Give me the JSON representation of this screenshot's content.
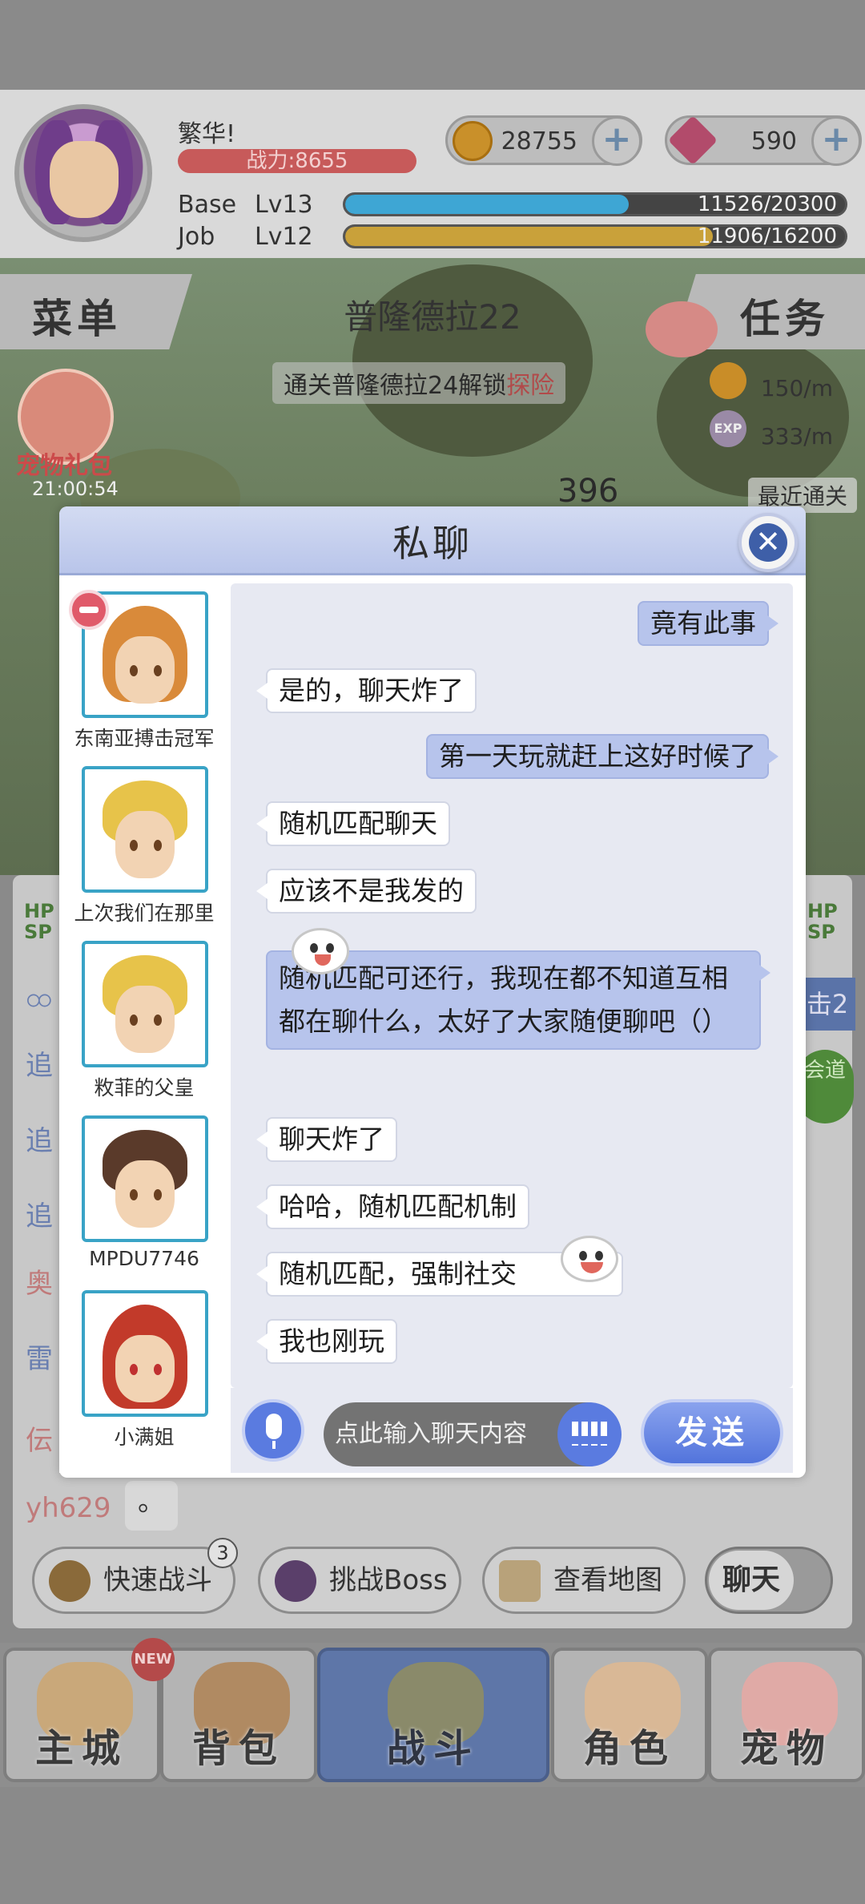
{
  "player": {
    "name": "繁华!",
    "power": "战力:8655",
    "base_label": "Base",
    "base_level": "Lv13",
    "base_exp": "11526/20300",
    "base_fraction": 0.568,
    "job_label": "Job",
    "job_level": "Lv12",
    "job_exp": "11906/16200",
    "job_fraction": 0.735
  },
  "currency": {
    "coins": "28755",
    "gems": "590",
    "plus": "+"
  },
  "hud": {
    "menu_label": "菜单",
    "task_label": "任务",
    "map_name": "普隆德拉22",
    "quest_hint_prefix": "通关普隆德拉24解锁",
    "quest_hint_action": "探险",
    "pet_gift_label": "宠物礼包",
    "pet_gift_timer": "21:00:54",
    "coin_rate": "150/m",
    "exp_rate": "333/m",
    "exp_tag": "EXP",
    "counter": "396",
    "recent_clear": "最近通关"
  },
  "background_chat": {
    "hp_tag": "HP",
    "sp_tag": "SP",
    "lines": [
      "ထ",
      "追",
      "追",
      "追",
      "奥",
      "雷",
      "伝"
    ],
    "last_sender": "yh629",
    "last_message": "。",
    "right_badge": "击2",
    "right_green": "会道"
  },
  "actions": {
    "quick_battle": "快速战斗",
    "quick_battle_badge": "3",
    "challenge_boss": "挑战Boss",
    "view_map": "查看地图",
    "chat_toggle": "聊天"
  },
  "nav": {
    "new_tag": "NEW",
    "items": [
      {
        "label": "主城"
      },
      {
        "label": "背包"
      },
      {
        "label": "战斗"
      },
      {
        "label": "角色"
      },
      {
        "label": "宠物"
      }
    ]
  },
  "private_chat": {
    "title": "私聊",
    "close": "✕",
    "contacts": [
      {
        "name": "东南亚搏击冠军"
      },
      {
        "name": "上次我们在那里"
      },
      {
        "name": "敉菲的父皇"
      },
      {
        "name": "MPDU7746"
      },
      {
        "name": "小满姐"
      }
    ],
    "messages": [
      {
        "side": "right",
        "text": "竟有此事"
      },
      {
        "side": "left",
        "text": "是的，聊天炸了"
      },
      {
        "side": "right",
        "text": "第一天玩就赶上这好时候了"
      },
      {
        "side": "left",
        "text": "随机匹配聊天"
      },
      {
        "side": "left",
        "text": "应该不是我发的"
      },
      {
        "side": "right",
        "text": "随机匹配可还行，我现在都不知道互相都在聊什么，太好了大家随便聊吧（）"
      },
      {
        "side": "left",
        "text": "聊天炸了"
      },
      {
        "side": "left",
        "text": "哈哈，随机匹配机制"
      },
      {
        "side": "left",
        "text": "随机匹配，强制社交"
      },
      {
        "side": "left",
        "text": "我也刚玩"
      }
    ],
    "input_placeholder": "点此输入聊天内容",
    "send_label": "发送"
  },
  "colors": {
    "accent_blue": "#5a7be0",
    "bubble_right": "#b7c4ec",
    "remove_red": "#e05a6a",
    "frame_cyan": "#39a3c6"
  }
}
